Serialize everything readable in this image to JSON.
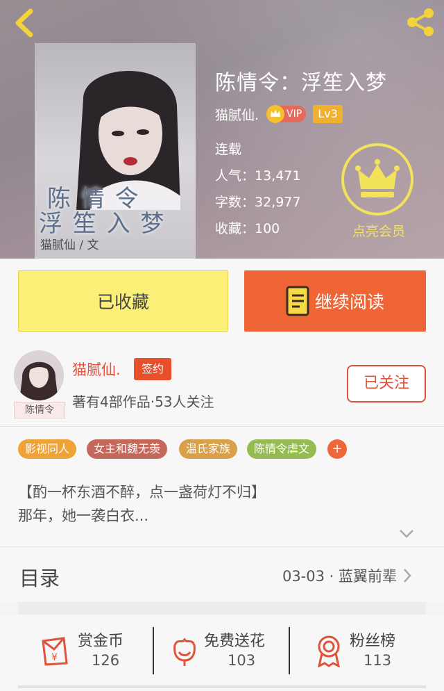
{
  "book": {
    "title": "陈情令：浮笙入梦",
    "author": "猫腻仙.",
    "vip_label": "VIP",
    "level": "Lv3",
    "status": "连载",
    "popularity": "人气：13,471",
    "word_count": "字数：32,977",
    "collections": "收藏：100",
    "cover_text": {
      "line1": "陈 情 令",
      "line2": "浮 笙 入 梦",
      "author": "猫腻仙 / 文"
    }
  },
  "member": {
    "label": "点亮会员"
  },
  "actions": {
    "collected_label": "已收藏",
    "read_label": "继续阅读"
  },
  "author_card": {
    "name": "猫腻仙.",
    "sign_badge": "签约",
    "stats": "著有4部作品·53人关注",
    "follow_label": "已关注",
    "avatar_tag": "陈情令"
  },
  "tags": [
    {
      "label": "影视同人",
      "color": "#efa337"
    },
    {
      "label": "女主和魏无羡",
      "color": "#c4685c"
    },
    {
      "label": "温氏家族",
      "color": "#d8a04a"
    },
    {
      "label": "陈情令虐文",
      "color": "#96bb52"
    }
  ],
  "tag_more": "+",
  "intro": {
    "line1": "【酌一杯东酒不醉，点一盏荷灯不归】",
    "line2": "那年，她一袭白衣..."
  },
  "toc": {
    "title": "目录",
    "latest": "03-03 · 蓝翼前辈"
  },
  "fan_actions": [
    {
      "label": "赏金币",
      "count": "126",
      "icon": "coin-envelope-icon"
    },
    {
      "label": "免费送花",
      "count": "103",
      "icon": "flower-icon"
    },
    {
      "label": "粉丝榜",
      "count": "113",
      "icon": "medal-icon"
    }
  ],
  "colors": {
    "accent": "#ef6536",
    "collected_bg": "#fbf077",
    "member_gold": "#f3e35a",
    "author_red": "#e4503c"
  }
}
